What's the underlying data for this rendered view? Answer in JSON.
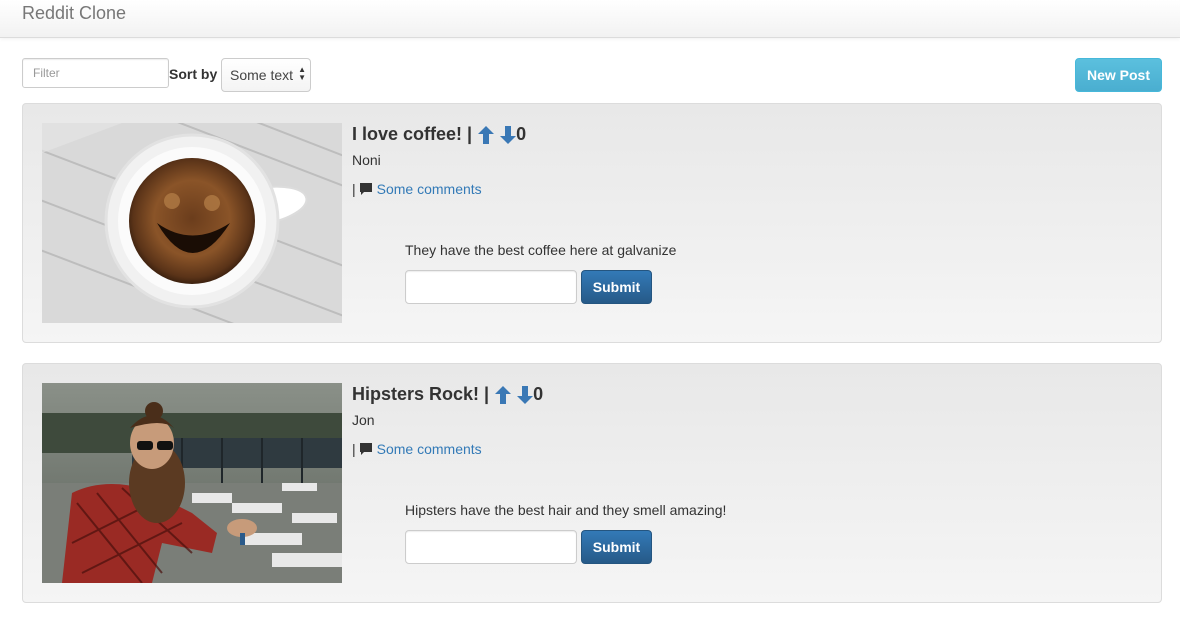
{
  "app": {
    "title": "Reddit Clone"
  },
  "toolbar": {
    "filter_placeholder": "Filter",
    "sort_label": "Sort by",
    "sort_selected": "Some text",
    "new_post_label": "New Post"
  },
  "posts": [
    {
      "title": "I love coffee!",
      "separator": "|",
      "votes": "0",
      "author": "Noni",
      "comments_separator": "|",
      "comments_link": "Some comments",
      "body": "They have the best coffee here at galvanize",
      "submit_label": "Submit",
      "image": "coffee-cup-photo"
    },
    {
      "title": "Hipsters Rock!",
      "separator": "|",
      "votes": "0",
      "author": "Jon",
      "comments_separator": "|",
      "comments_link": "Some comments",
      "body": "Hipsters have the best hair and they smell amazing!",
      "submit_label": "Submit",
      "image": "hipster-man-photo"
    }
  ],
  "colors": {
    "link": "#337ab7",
    "primary_button": "#2e6da4",
    "info_button": "#5bc0de",
    "arrow": "#3a78b5"
  }
}
